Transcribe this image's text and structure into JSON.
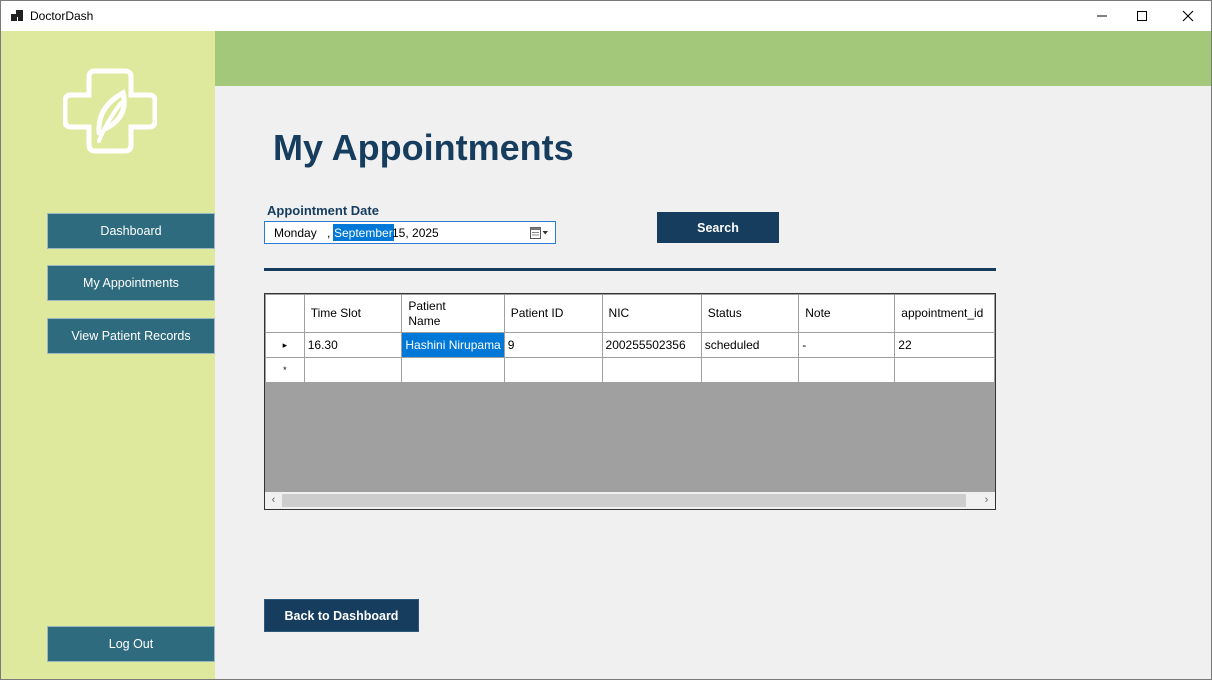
{
  "window": {
    "title": "DoctorDash",
    "icon": "app-window-icon"
  },
  "sidebar": {
    "logo": "medical-cross-leaf-logo",
    "items": [
      {
        "label": "Dashboard"
      },
      {
        "label": "My Appointments"
      },
      {
        "label": "View Patient Records"
      }
    ],
    "logout_label": "Log Out"
  },
  "main": {
    "title": "My Appointments",
    "date_label": "Appointment Date",
    "date": {
      "day": "Monday",
      "comma": ",",
      "month": "September",
      "rest": "15, 2025"
    },
    "search_label": "Search",
    "back_label": "Back to Dashboard"
  },
  "grid": {
    "columns": [
      "Time Slot",
      "Patient\nName",
      "Patient ID",
      "NIC",
      "Status",
      "Note",
      "appointment_id"
    ],
    "rows": [
      [
        "16.30",
        "Hashini Nirupama",
        "9",
        "200255502356",
        "scheduled",
        "-",
        "22"
      ]
    ],
    "current_row_marker": "▸",
    "new_row_marker": "*"
  },
  "colors": {
    "sidebar_bg": "#dfe99e",
    "header_band": "#a3c87a",
    "nav_button": "#2e6b7e",
    "primary_dark": "#163d5e",
    "selection": "#0078d7"
  }
}
